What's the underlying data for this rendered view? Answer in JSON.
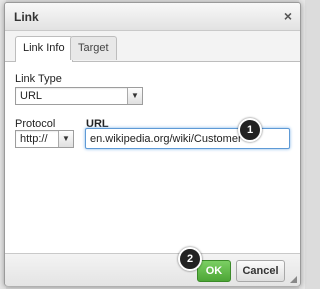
{
  "dialog": {
    "title": "Link",
    "close_icon": "close-icon",
    "tabs": [
      {
        "label": "Link Info",
        "active": true
      },
      {
        "label": "Target",
        "active": false
      }
    ],
    "link_type": {
      "label": "Link Type",
      "value": "URL"
    },
    "protocol": {
      "label": "Protocol",
      "value": "http://"
    },
    "url": {
      "label": "URL",
      "value": "en.wikipedia.org/wiki/Customer"
    },
    "ok_label": "OK",
    "cancel_label": "Cancel"
  },
  "callouts": {
    "step1": "1",
    "step2": "2"
  },
  "colors": {
    "ok_button": "#5cb443",
    "focus_border": "#5e9ad6",
    "callout": "#222222"
  }
}
